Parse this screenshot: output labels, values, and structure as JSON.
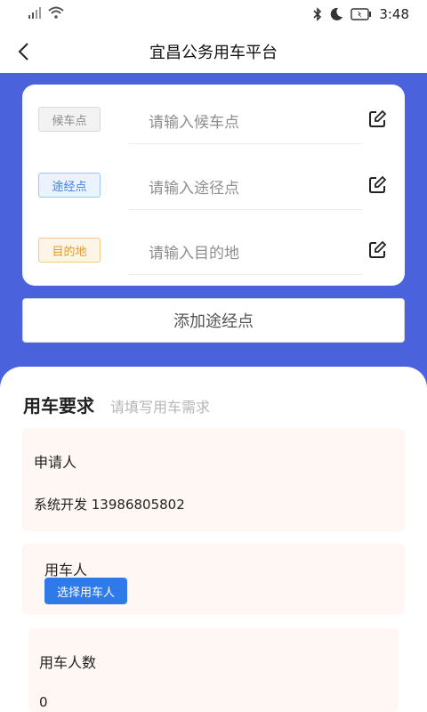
{
  "status_bar": {
    "time": "3:48"
  },
  "nav": {
    "title": "宜昌公务用车平台"
  },
  "route": {
    "stops": [
      {
        "tag": "候车点",
        "placeholder": "请输入候车点"
      },
      {
        "tag": "途经点",
        "placeholder": "请输入途径点"
      },
      {
        "tag": "目的地",
        "placeholder": "请输入目的地"
      }
    ],
    "add_button": "添加途经点"
  },
  "requirements": {
    "title": "用车要求",
    "subtitle": "请填写用车需求",
    "applicant": {
      "label": "申请人",
      "value": "系统开发 13986805802"
    },
    "user": {
      "label": "用车人",
      "button": "选择用车人"
    },
    "count": {
      "label": "用车人数",
      "value": "0"
    }
  }
}
